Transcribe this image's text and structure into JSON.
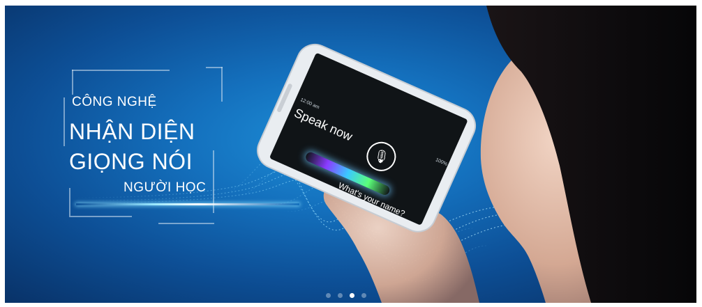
{
  "banner": {
    "line1": "CÔNG NGHỆ",
    "line2": "NHẬN DIỆN",
    "line3": "GIỌNG NÓI",
    "line4": "NGƯỜI HỌC"
  },
  "phone": {
    "title": "Speak now",
    "prompt": "What's your name?",
    "status_time": "12:00 am",
    "status_battery": "100%",
    "mic_icon": "microphone-icon"
  },
  "carousel": {
    "slide_count": 4,
    "active_slide": 3
  },
  "colors": {
    "background": "#1470bd",
    "accent_glow": "#9ae8ff",
    "text": "#ffffff"
  }
}
